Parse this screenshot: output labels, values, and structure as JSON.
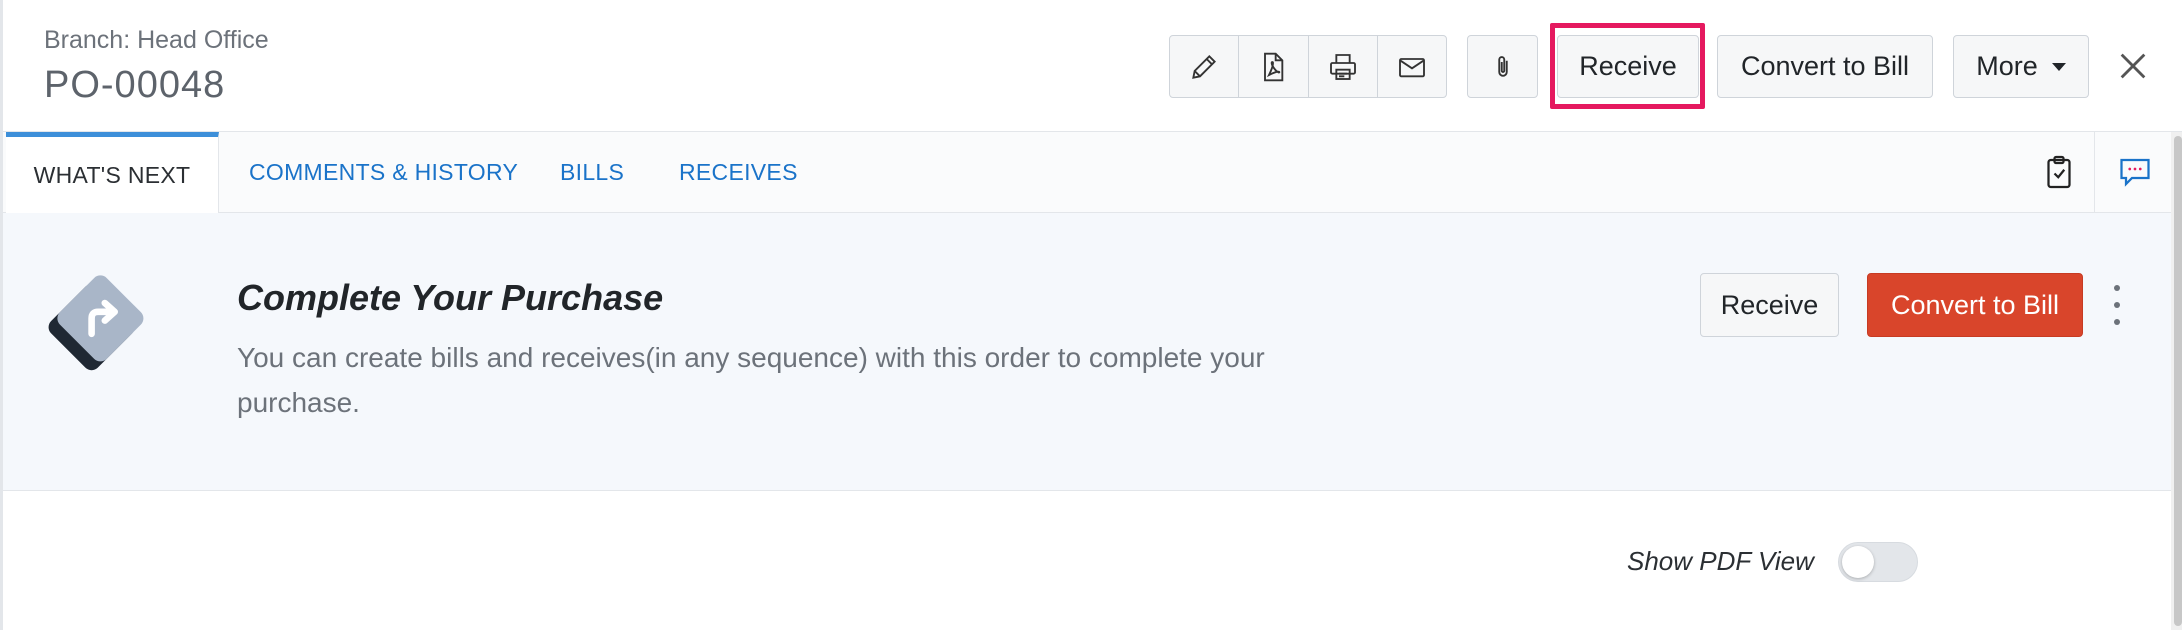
{
  "header": {
    "branch": "Branch: Head Office",
    "title": "PO-00048",
    "icons": [
      "pencil-icon",
      "pdf-icon",
      "printer-icon",
      "mail-icon",
      "paperclip-icon"
    ],
    "receive_label": "Receive",
    "convert_label": "Convert to Bill",
    "more_label": "More"
  },
  "tabs": [
    {
      "label": "WHAT'S NEXT",
      "active": true
    },
    {
      "label": "COMMENTS & HISTORY"
    },
    {
      "label": "BILLS"
    },
    {
      "label": "RECEIVES"
    }
  ],
  "next": {
    "title": "Complete Your Purchase",
    "description": "You can create bills and receives(in any sequence) with this order to complete your purchase.",
    "receive_label": "Receive",
    "convert_label": "Convert to Bill"
  },
  "pdf_toggle": {
    "label": "Show PDF View",
    "on": false
  },
  "colors": {
    "primary_red": "#d9452b",
    "tab_blue": "#1a73c9",
    "highlight_pink": "#e5195f"
  }
}
